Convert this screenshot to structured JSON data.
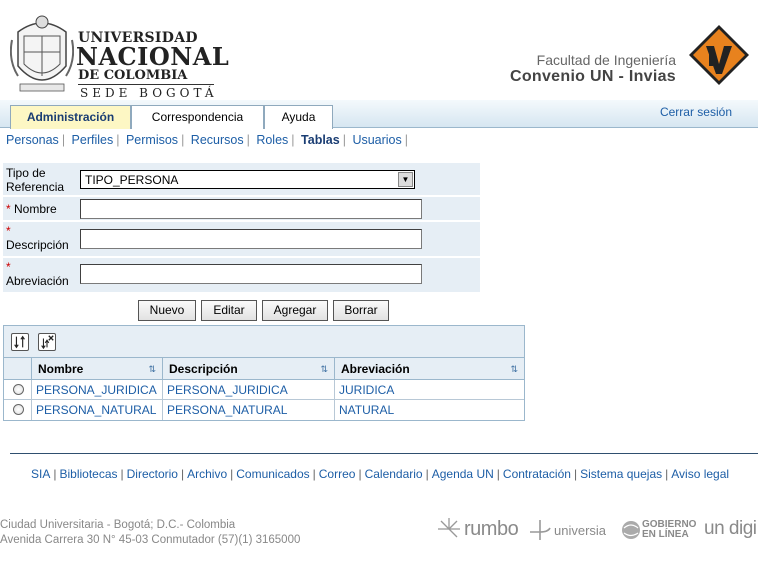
{
  "header": {
    "university_line1": "UNIVERSIDAD",
    "university_line2": "NACIONAL",
    "university_line3": "DE COLOMBIA",
    "university_line4": "SEDE BOGOTÁ",
    "faculty": "Facultad de Ingeniería",
    "convenio": "Convenio UN - Invias"
  },
  "nav": {
    "tabs": [
      {
        "label": "Administración",
        "active": true
      },
      {
        "label": "Correspondencia",
        "active": false
      },
      {
        "label": "Ayuda",
        "active": false
      }
    ],
    "logout": "Cerrar sesión"
  },
  "subnav": {
    "items": [
      {
        "label": "Personas"
      },
      {
        "label": "Perfiles"
      },
      {
        "label": "Permisos"
      },
      {
        "label": "Recursos"
      },
      {
        "label": "Roles"
      },
      {
        "label": "Tablas",
        "active": true
      },
      {
        "label": "Usuarios"
      }
    ]
  },
  "form": {
    "tipo_label_1": "Tipo de",
    "tipo_label_2": "Referencia",
    "tipo_value": "TIPO_PERSONA",
    "required_mark": "*",
    "nombre_label": "Nombre",
    "nombre_value": "",
    "descripcion_label": "Descripción",
    "descripcion_value": "",
    "abreviacion_label": "Abreviación",
    "abreviacion_value": ""
  },
  "buttons": {
    "nuevo": "Nuevo",
    "editar": "Editar",
    "agregar": "Agregar",
    "borrar": "Borrar"
  },
  "table": {
    "columns": [
      "Nombre",
      "Descripción",
      "Abreviación"
    ],
    "sort_glyph": "⇅",
    "rows": [
      {
        "nombre": "PERSONA_JURIDICA",
        "descripcion": "PERSONA_JURIDICA",
        "abreviacion": "JURIDICA"
      },
      {
        "nombre": "PERSONA_NATURAL",
        "descripcion": "PERSONA_NATURAL",
        "abreviacion": "NATURAL"
      }
    ]
  },
  "footer": {
    "links": [
      "SIA",
      "Bibliotecas",
      "Directorio",
      "Archivo",
      "Comunicados",
      "Correo",
      "Calendario",
      "Agenda UN",
      "Contratación",
      "Sistema quejas",
      "Aviso legal"
    ],
    "address_line1": "Ciudad Universitaria - Bogotá; D.C.- Colombia",
    "address_line2": "Avenida Carrera 30 N° 45-03 Conmutador (57)(1) 3165000",
    "brands": {
      "rumbo": "rumbo",
      "universia": "universia",
      "gobierno_1": "GOBIERNO",
      "gobierno_2": "EN LÍNEA",
      "undigital": "un digi"
    }
  },
  "colors": {
    "link": "#1d5ea6",
    "invias_orange": "#e8821e",
    "active_tab_bg": "#fdf7c4",
    "panel_bg": "#e6eef5"
  }
}
